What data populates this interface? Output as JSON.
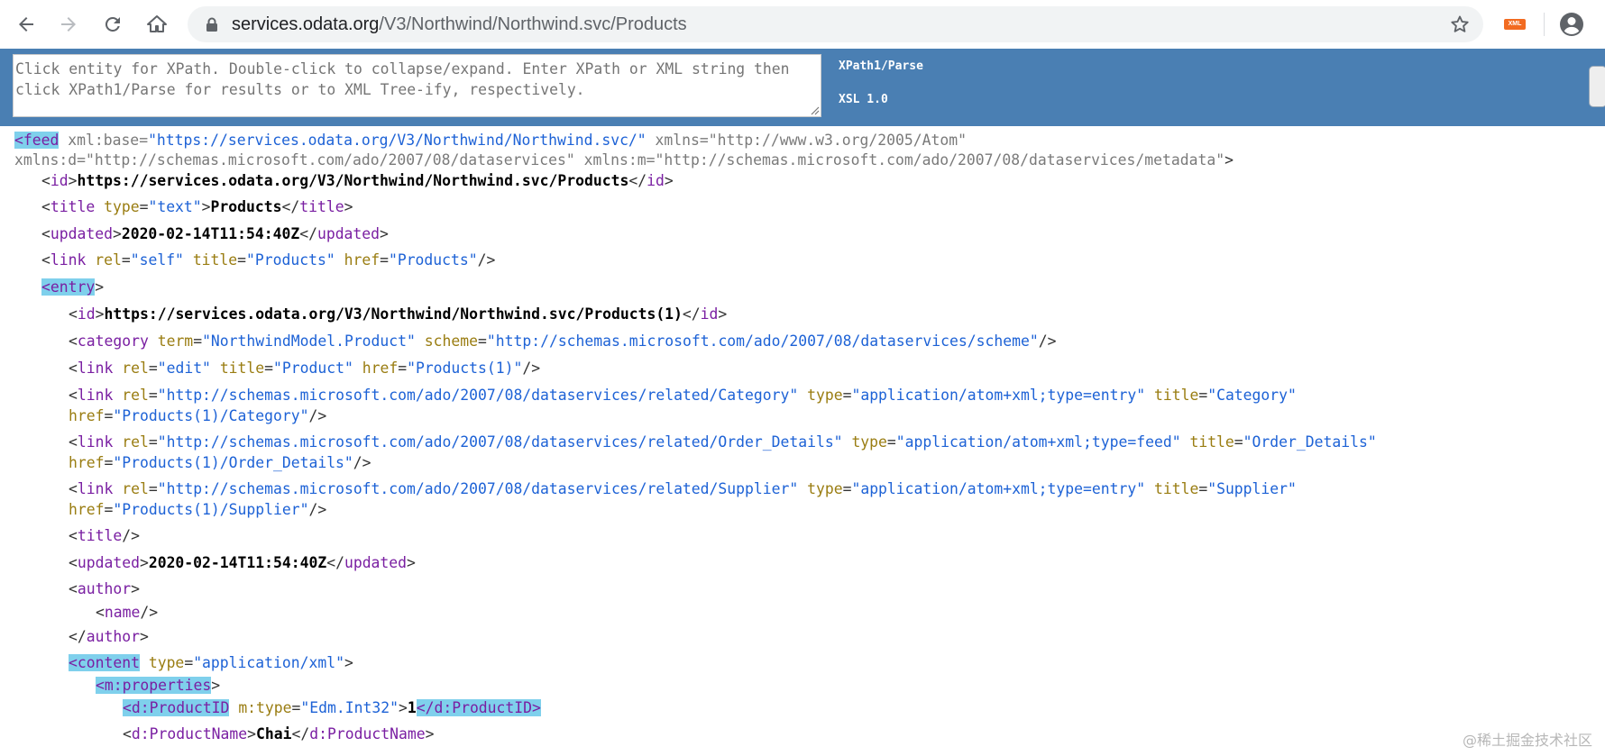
{
  "browser": {
    "url_host": "services.odata.org",
    "url_path": "/V3/Northwind/Northwind.svc/Products",
    "extension_badge": "XML"
  },
  "xpath_panel": {
    "placeholder": "Click entity for XPath. Double-click to collapse/expand. Enter XPath or XML string then click XPath1/Parse for results or to XML Tree-ify, respectively.",
    "parse_button": "XPath1/Parse",
    "xsl_button": "XSL 1.0"
  },
  "xml": {
    "feed": {
      "tag": "feed",
      "a1_name": "xml:base",
      "a1_value": "\"https://services.odata.org/V3/Northwind/Northwind.svc/\"",
      "a2_name": "xmlns",
      "a2_value": "\"http://www.w3.org/2005/Atom\"",
      "a3_name": "xmlns:d",
      "a3_value": "\"http://schemas.microsoft.com/ado/2007/08/dataservices\"",
      "a4_name": "xmlns:m",
      "a4_value": "\"http://schemas.microsoft.com/ado/2007/08/dataservices/metadata\""
    },
    "feed_id": {
      "tag": "id",
      "text": "https://services.odata.org/V3/Northwind/Northwind.svc/Products"
    },
    "feed_title": {
      "tag": "title",
      "attr_name": "type",
      "attr_value": "\"text\"",
      "text": "Products"
    },
    "feed_updated": {
      "tag": "updated",
      "text": "2020-02-14T11:54:40Z"
    },
    "feed_link": {
      "tag": "link",
      "rel_name": "rel",
      "rel_value": "\"self\"",
      "title_name": "title",
      "title_value": "\"Products\"",
      "href_name": "href",
      "href_value": "\"Products\""
    },
    "entry": {
      "tag": "entry",
      "id": {
        "tag": "id",
        "text": "https://services.odata.org/V3/Northwind/Northwind.svc/Products(1)"
      },
      "category": {
        "tag": "category",
        "term_name": "term",
        "term_value": "\"NorthwindModel.Product\"",
        "scheme_name": "scheme",
        "scheme_value": "\"http://schemas.microsoft.com/ado/2007/08/dataservices/scheme\""
      },
      "link_edit": {
        "tag": "link",
        "rel_name": "rel",
        "rel_value": "\"edit\"",
        "title_name": "title",
        "title_value": "\"Product\"",
        "href_name": "href",
        "href_value": "\"Products(1)\""
      },
      "link_category": {
        "tag": "link",
        "rel_name": "rel",
        "rel_value": "\"http://schemas.microsoft.com/ado/2007/08/dataservices/related/Category\"",
        "type_name": "type",
        "type_value": "\"application/atom+xml;type=entry\"",
        "title_name": "title",
        "title_value": "\"Category\"",
        "href_name": "href",
        "href_value": "\"Products(1)/Category\""
      },
      "link_order_details": {
        "tag": "link",
        "rel_name": "rel",
        "rel_value": "\"http://schemas.microsoft.com/ado/2007/08/dataservices/related/Order_Details\"",
        "type_name": "type",
        "type_value": "\"application/atom+xml;type=feed\"",
        "title_name": "title",
        "title_value": "\"Order_Details\"",
        "href_name": "href",
        "href_value": "\"Products(1)/Order_Details\""
      },
      "link_supplier": {
        "tag": "link",
        "rel_name": "rel",
        "rel_value": "\"http://schemas.microsoft.com/ado/2007/08/dataservices/related/Supplier\"",
        "type_name": "type",
        "type_value": "\"application/atom+xml;type=entry\"",
        "title_name": "title",
        "title_value": "\"Supplier\"",
        "href_name": "href",
        "href_value": "\"Products(1)/Supplier\""
      },
      "title_empty": {
        "tag": "title"
      },
      "updated": {
        "tag": "updated",
        "text": "2020-02-14T11:54:40Z"
      },
      "author": {
        "tag": "author",
        "name_tag": "name"
      },
      "content": {
        "tag": "content",
        "type_name": "type",
        "type_value": "\"application/xml\"",
        "properties_tag": "m:properties",
        "product_id": {
          "tag": "d:ProductID",
          "attr_name": "m:type",
          "attr_value": "\"Edm.Int32\"",
          "text": "1"
        },
        "product_name": {
          "tag": "d:ProductName",
          "text": "Chai"
        }
      }
    }
  },
  "watermark": "@稀土掘金技术社区"
}
